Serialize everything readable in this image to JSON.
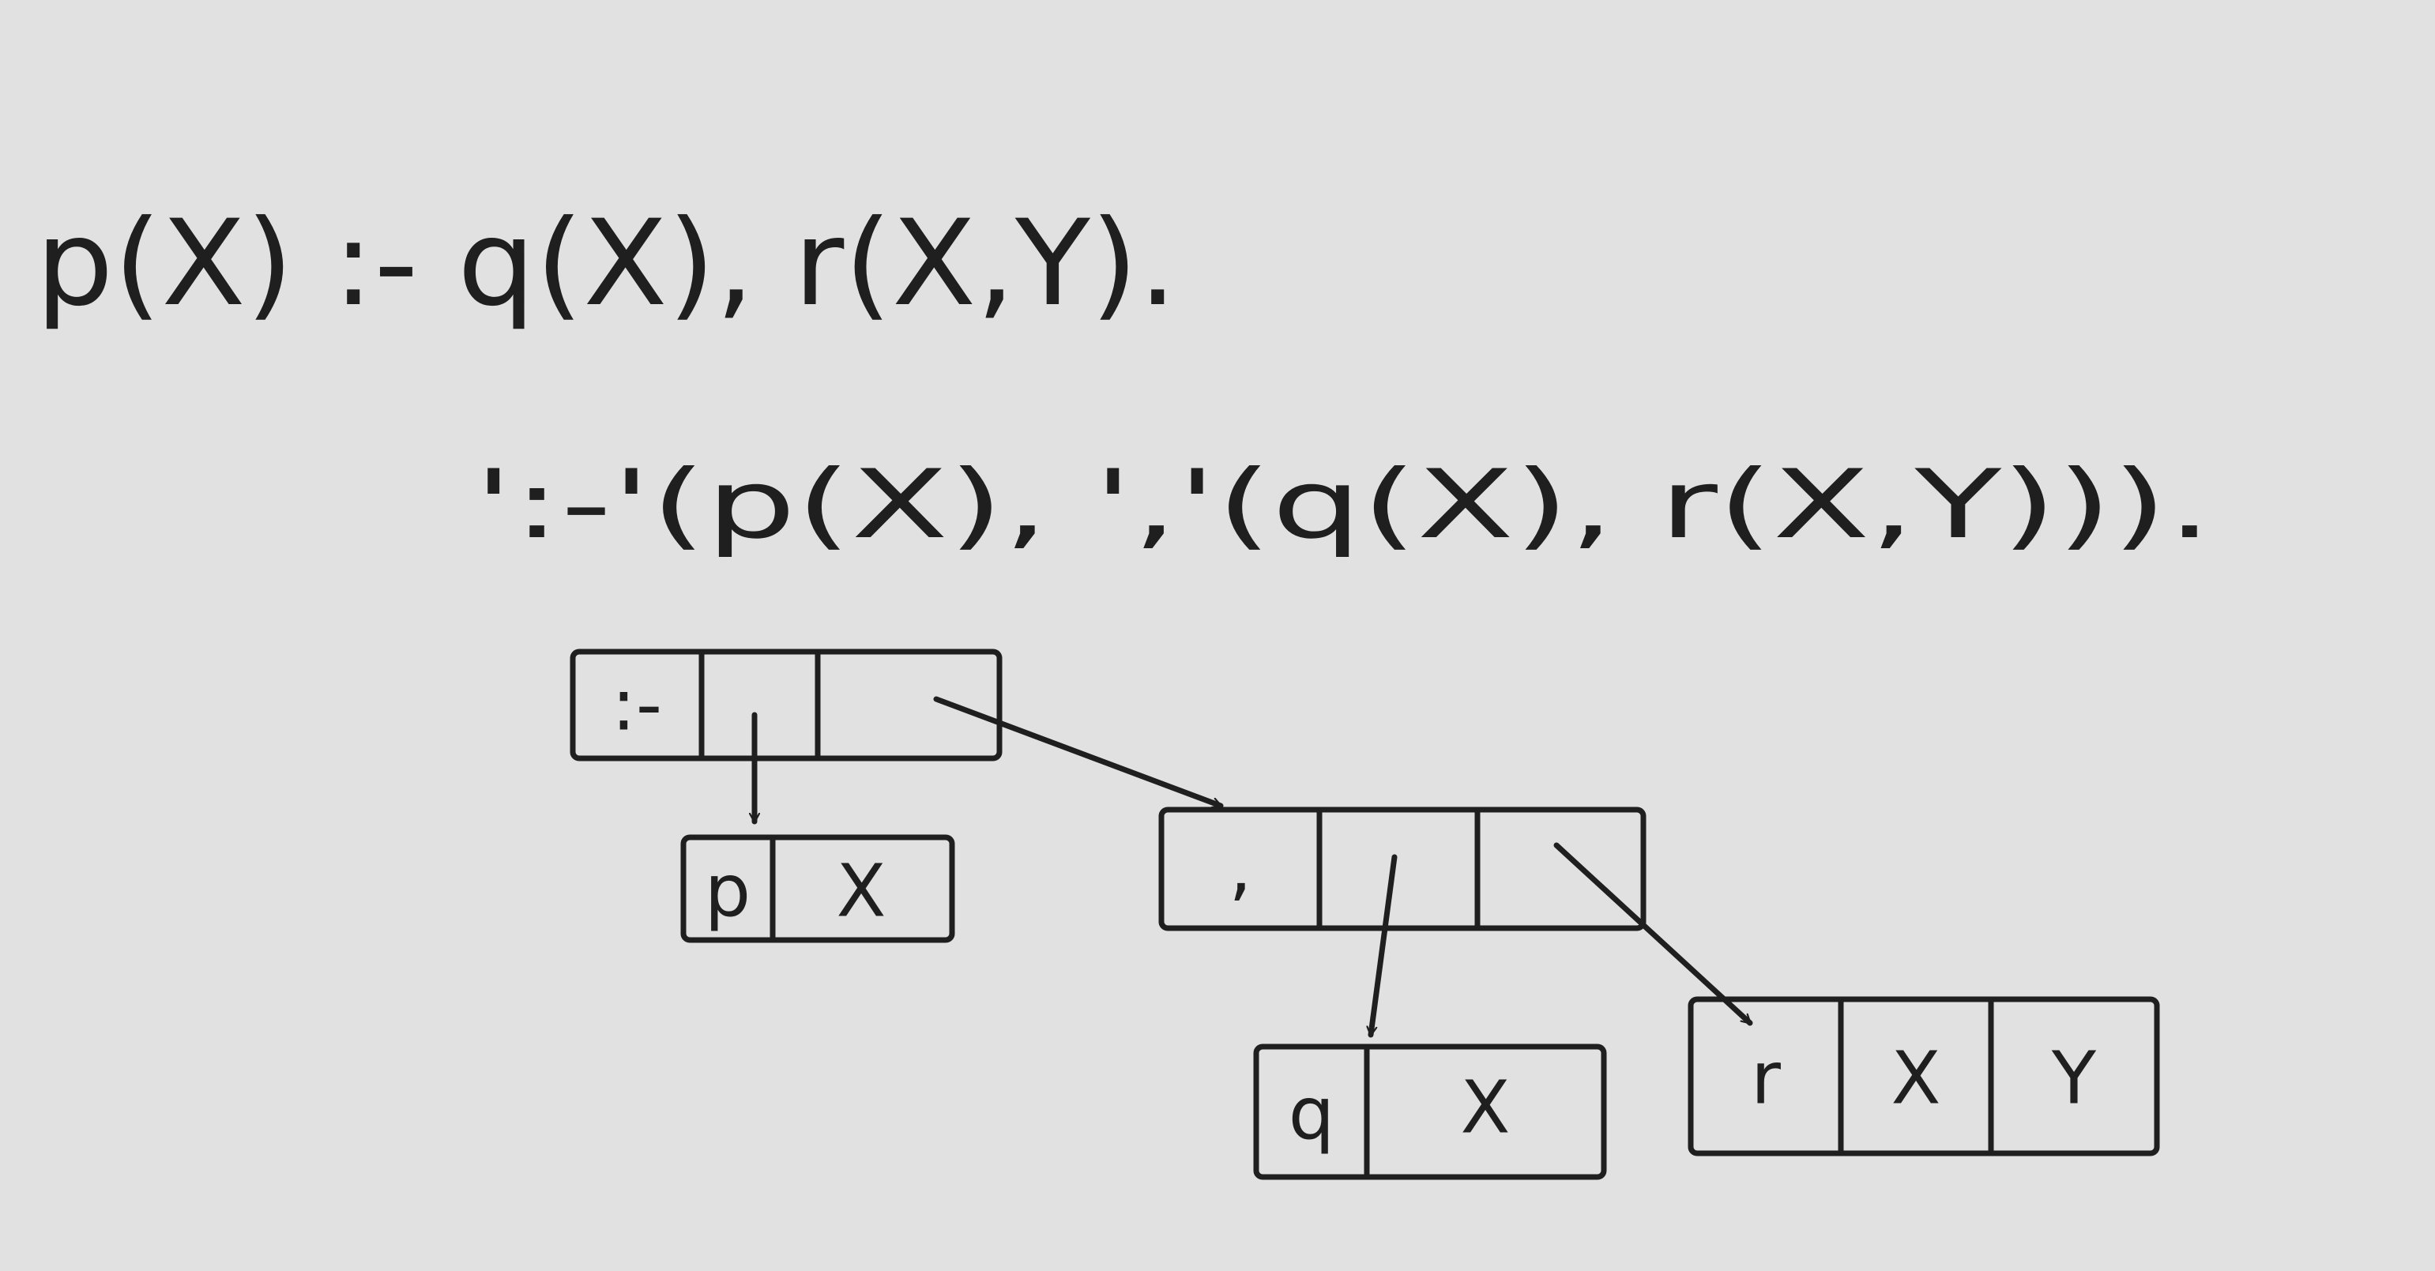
{
  "clause_text": "p(X) :- q(X), r(X,Y).",
  "term_text": "':-'(p(X), ','(q(X), r(X,Y))).",
  "structures": {
    "root": {
      "cells": [
        ":-",
        "",
        ""
      ]
    },
    "head": {
      "cells": [
        "p",
        "X"
      ]
    },
    "body": {
      "cells": [
        ",",
        "",
        ""
      ]
    },
    "goal_q": {
      "cells": [
        "q",
        "X"
      ]
    },
    "goal_r": {
      "cells": [
        "r",
        "X",
        "Y"
      ]
    }
  },
  "colors": {
    "background": "#e1e1e1",
    "ink": "#1f1f1f"
  }
}
